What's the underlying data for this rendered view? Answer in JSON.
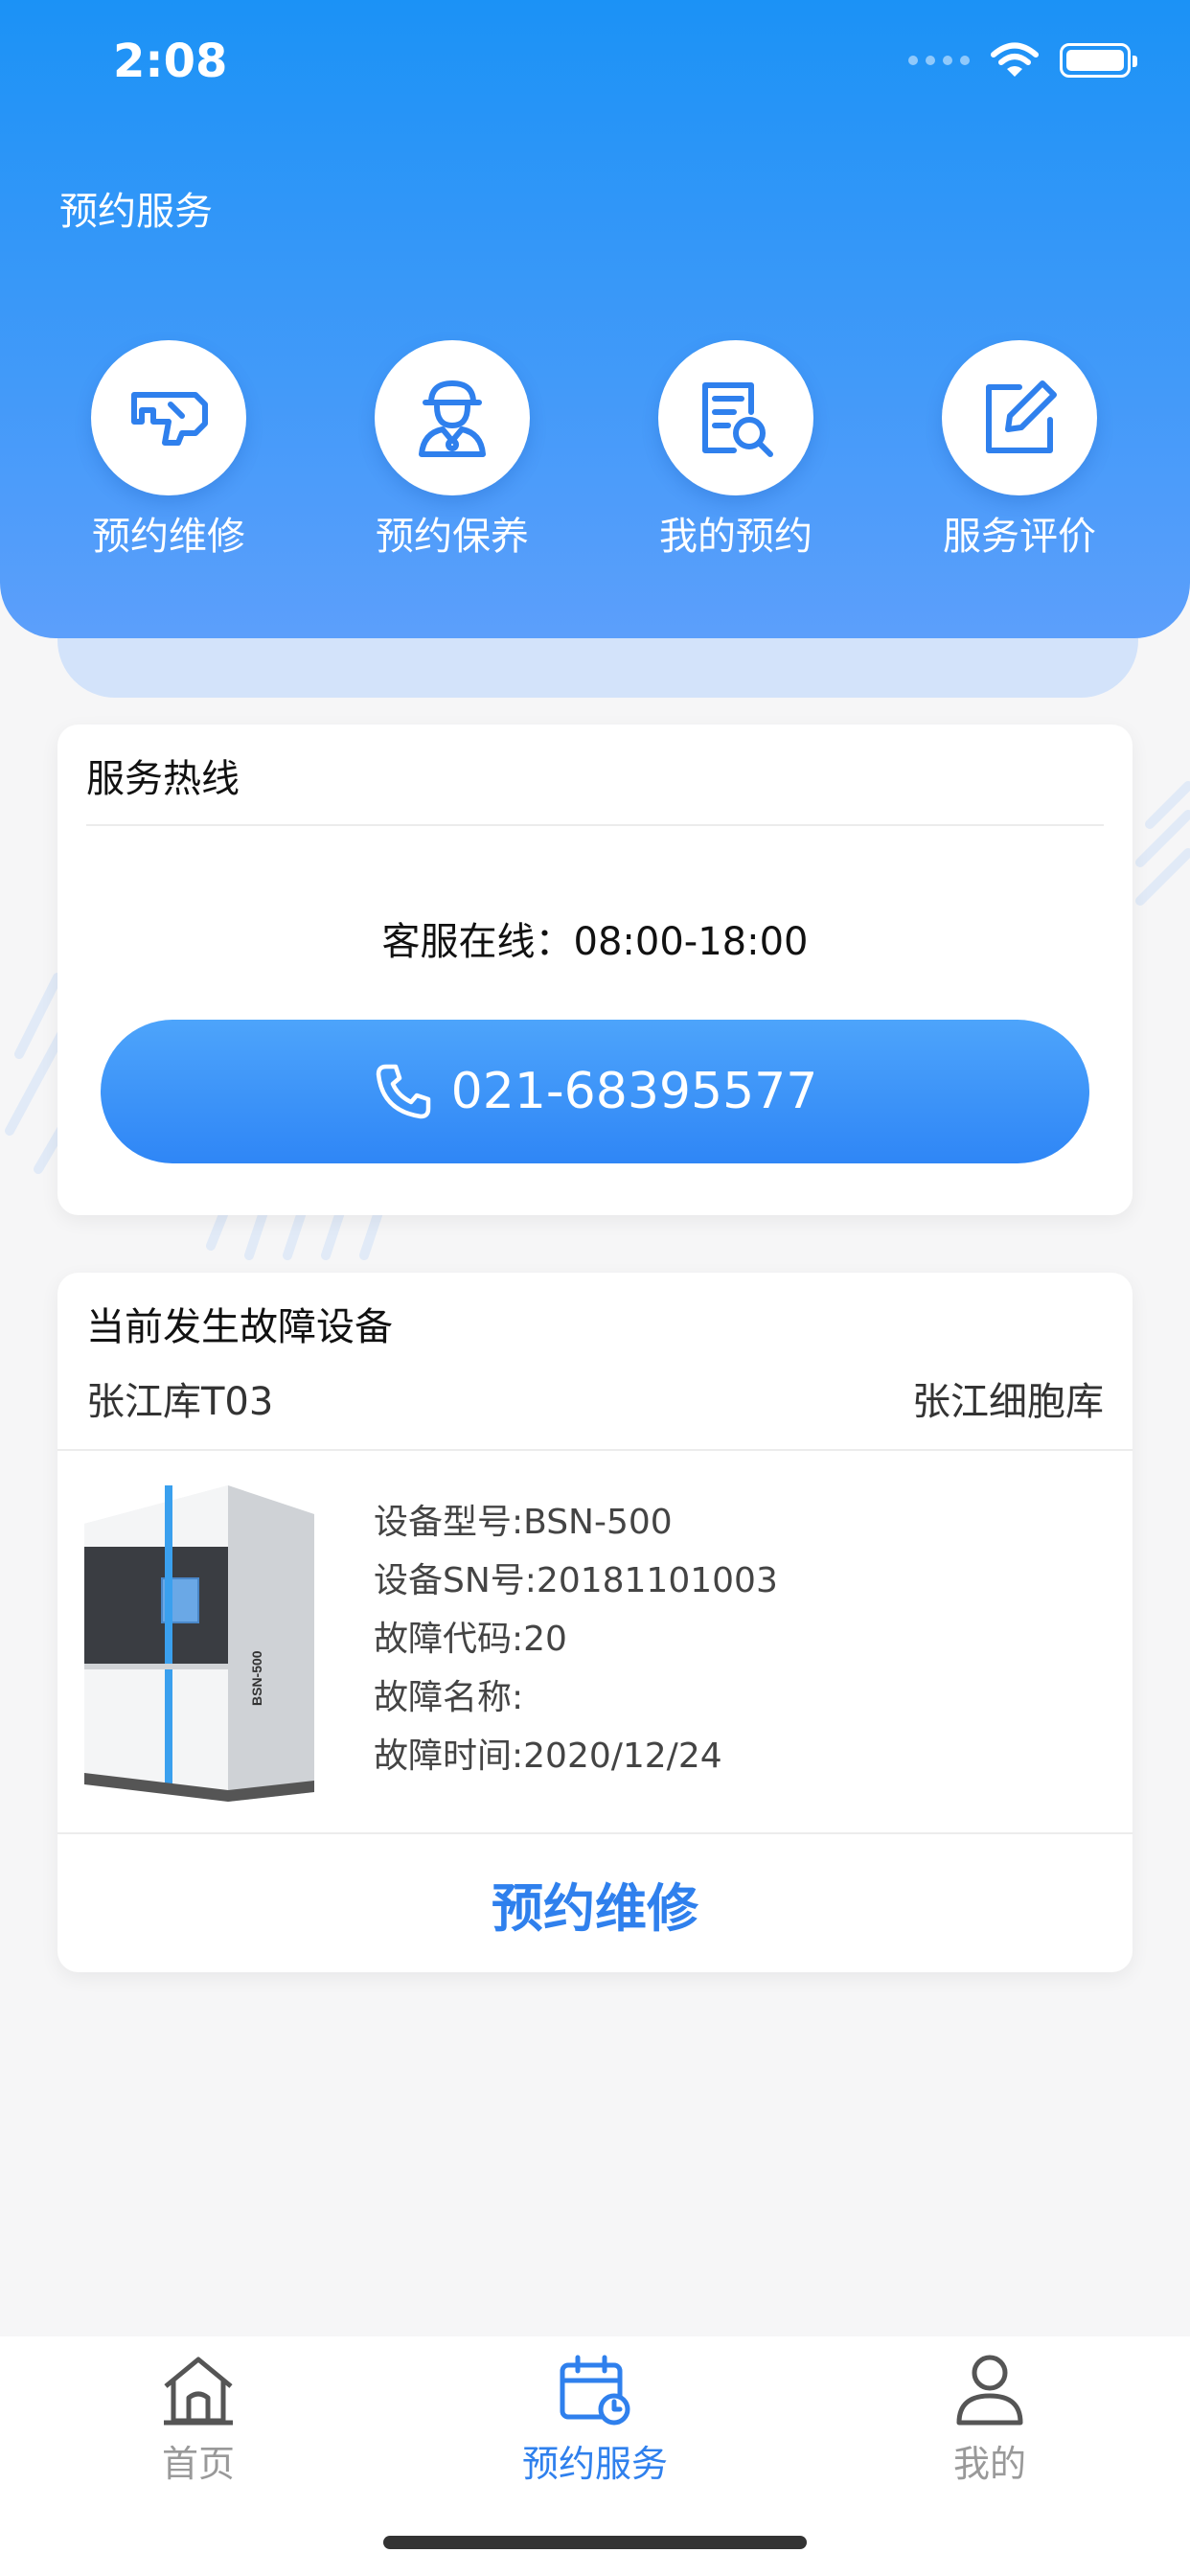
{
  "status_bar": {
    "time": "2:08"
  },
  "header": {
    "title": "预约服务"
  },
  "quick_actions": [
    {
      "label": "预约维修",
      "icon": "drill-icon"
    },
    {
      "label": "预约保养",
      "icon": "technician-icon"
    },
    {
      "label": "我的预约",
      "icon": "document-search-icon"
    },
    {
      "label": "服务评价",
      "icon": "edit-square-icon"
    }
  ],
  "hotline": {
    "title": "服务热线",
    "hours": "客服在线：08:00-18:00",
    "phone": "021-68395577"
  },
  "fault": {
    "title": "当前发生故障设备",
    "location_left": "张江库T03",
    "location_right": "张江细胞库",
    "model": "设备型号:BSN-500",
    "sn": "设备SN号:20181101003",
    "code": "故障代码:20",
    "name": "故障名称:",
    "time": "故障时间:2020/12/24",
    "button": "预约维修"
  },
  "tabs": [
    {
      "label": "首页",
      "icon": "home-icon"
    },
    {
      "label": "预约服务",
      "icon": "calendar-clock-icon"
    },
    {
      "label": "我的",
      "icon": "user-icon"
    }
  ],
  "colors": {
    "primary": "#2f80ed",
    "header_top": "#1b92f6",
    "header_bottom": "#5c9ffb"
  }
}
